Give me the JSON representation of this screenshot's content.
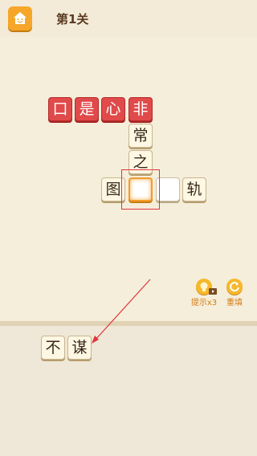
{
  "header": {
    "level_title": "第1关"
  },
  "board": {
    "row1": [
      "口",
      "是",
      "心",
      "非"
    ],
    "column": [
      "常",
      "之"
    ],
    "row3_left": "图",
    "row3_right": "轨"
  },
  "tools": {
    "hint_label": "提示",
    "hint_count": "x3",
    "reset_label": "重填"
  },
  "tray": {
    "chars": [
      "不",
      "谋"
    ]
  },
  "colors": {
    "red_tile": "#e04a4a",
    "accent": "#f6a628",
    "highlight": "#e0363a"
  }
}
